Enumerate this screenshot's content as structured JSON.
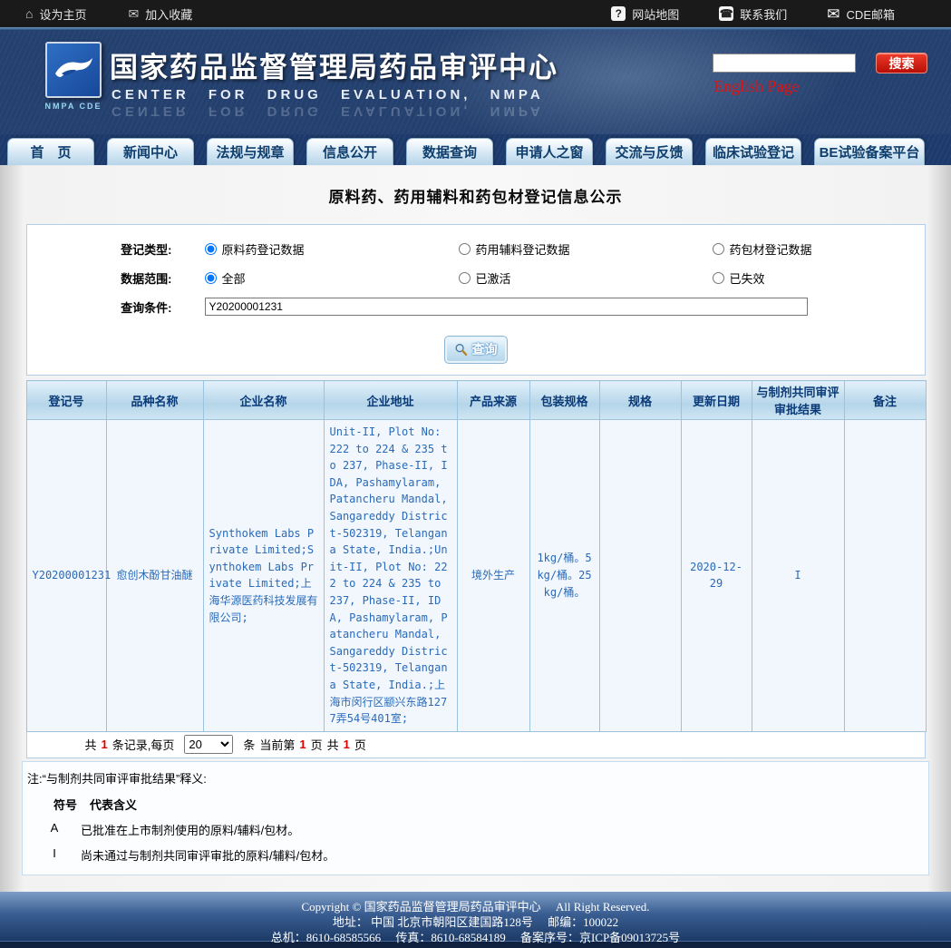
{
  "colors": {
    "header_navy": "#24406e",
    "accent_red": "#cc1a10",
    "cell_blue": "#2a6ab8",
    "red_number": "#e00000",
    "table_header_blue": "#0a3a78"
  },
  "topbar": {
    "set_home": "设为主页",
    "add_favorite": "加入收藏",
    "sitemap": "网站地图",
    "contact": "联系我们",
    "cde_mail": "CDE邮箱",
    "sitemap_glyph": "?"
  },
  "header": {
    "logo_label": "NMPA CDE",
    "title_cn": "国家药品监督管理局药品审评中心",
    "title_en": "CENTER FOR DRUG EVALUATION, NMPA",
    "search_value": "",
    "search_button": "搜索",
    "english_page": "English Page"
  },
  "nav": {
    "tabs": [
      {
        "label": "首　页"
      },
      {
        "label": "新闻中心"
      },
      {
        "label": "法规与规章"
      },
      {
        "label": "信息公开"
      },
      {
        "label": "数据查询"
      },
      {
        "label": "申请人之窗"
      },
      {
        "label": "交流与反馈"
      },
      {
        "label": "临床试验登记"
      },
      {
        "label": "BE试验备案平台"
      }
    ]
  },
  "page": {
    "title": "原料药、药用辅料和药包材登记信息公示"
  },
  "form": {
    "reg_type": {
      "label": "登记类型:",
      "options": [
        {
          "label": "原料药登记数据",
          "checked": true
        },
        {
          "label": "药用辅料登记数据",
          "checked": false
        },
        {
          "label": "药包材登记数据",
          "checked": false
        }
      ]
    },
    "scope": {
      "label": "数据范围:",
      "options": [
        {
          "label": "全部",
          "checked": true
        },
        {
          "label": "已激活",
          "checked": false
        },
        {
          "label": "已失效",
          "checked": false
        }
      ]
    },
    "query": {
      "label": "查询条件:",
      "value": "Y20200001231"
    },
    "submit_label": "查询"
  },
  "table": {
    "headers": [
      "登记号",
      "品种名称",
      "企业名称",
      "企业地址",
      "产品来源",
      "包装规格",
      "规格",
      "更新日期",
      "与制剂共同审评审批结果",
      "备注"
    ],
    "rows": [
      [
        "Y20200001231",
        "愈创木酚甘油醚",
        "Synthokem Labs Private Limited;Synthokem Labs Private Limited;上海华源医药科技发展有限公司;",
        "Unit-II, Plot No: 222 to 224 & 235 to 237, Phase-II, IDA, Pashamylaram, Patancheru Mandal, Sangareddy District-502319, Telangana State, India.;Unit-II, Plot No: 222 to 224 & 235 to 237, Phase-II, IDA, Pashamylaram, Patancheru Mandal, Sangareddy District-502319, Telangana State, India.;上海市闵行区颛兴东路1277弄54号401室;",
        "境外生产",
        "1kg/桶。5kg/桶。25kg/桶。",
        "",
        "2020-12-29",
        "I",
        ""
      ]
    ]
  },
  "pagination": {
    "total_prefix": "共",
    "total_records": "1",
    "records_suffix": "条记录,每页",
    "page_size": "20",
    "unit": "条",
    "current_prefix": "当前第",
    "current_page": "1",
    "current_suffix": "页",
    "pages_prefix": "共",
    "total_pages": "1",
    "pages_suffix": "页"
  },
  "notes": {
    "title": "注:“与制剂共同审评审批结果”释义:",
    "col_symbol": "符号",
    "col_meaning": "代表含义",
    "items": [
      {
        "symbol": "A",
        "meaning": "已批准在上市制剂使用的原料/辅料/包材。"
      },
      {
        "symbol": "I",
        "meaning": "尚未通过与制剂共同审评审批的原料/辅料/包材。"
      }
    ]
  },
  "footer": {
    "line1": "Copyright © 国家药品监督管理局药品审评中心　 All Right Reserved.",
    "line2": "地址： 中国 北京市朝阳区建国路128号　 邮编：100022",
    "line3": "总机：8610-68585566　 传真：8610-68584189　 备案序号：京ICP备09013725号"
  }
}
